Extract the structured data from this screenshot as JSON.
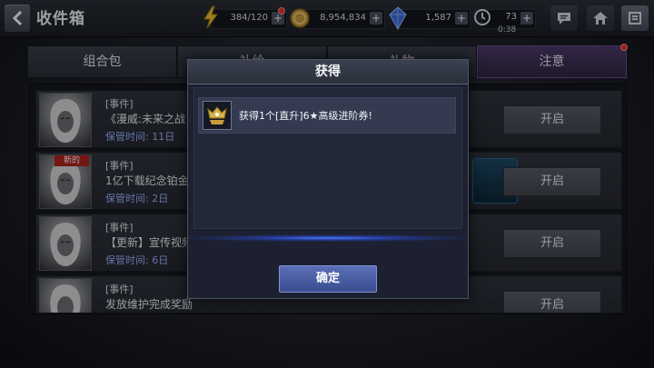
{
  "header": {
    "title": "收件箱",
    "back_icon": "chevron-left-icon",
    "energy": {
      "value": "384/120",
      "icon": "lightning-icon",
      "plus": "+"
    },
    "gold": {
      "value": "8,954,834",
      "icon": "coin-icon",
      "plus": "+"
    },
    "crystal": {
      "value": "1,587",
      "icon": "crystal-icon",
      "plus": "+"
    },
    "stamina": {
      "value": "73",
      "timer": "0:38",
      "icon": "timer-icon",
      "plus": "+"
    },
    "chat_icon": "chat-icon",
    "home_icon": "home-icon",
    "menu_icon": "menu-icon"
  },
  "tabs": [
    {
      "label": "组合包"
    },
    {
      "label": "补给"
    },
    {
      "label": "礼物"
    },
    {
      "label": "注意",
      "active": true
    }
  ],
  "mail_items": [
    {
      "category": "[事件]",
      "title": "《漫威:未来之战",
      "hold_time": "保管时间: 11日",
      "button": "开启"
    },
    {
      "category": "[事件]",
      "title": "1亿下载纪念铂金",
      "hold_time": "保管时间: 2日",
      "button": "开启",
      "badge": "新的"
    },
    {
      "category": "[事件]",
      "title": "【更新】宣传视频",
      "hold_time": "保管时间: 6日",
      "button": "开启"
    },
    {
      "category": "[事件]",
      "title": "发放维护完成奖励",
      "hold_time": "",
      "button": "开启"
    }
  ],
  "modal": {
    "title": "获得",
    "reward_text": "获得1个[直升]6★高级进阶券!",
    "reward_icon": "rank-badge-icon",
    "confirm": "确定"
  },
  "colors": {
    "accent_blue": "#4a78ff",
    "active_tab": "#4e3a6e",
    "badge_red": "#b3231d",
    "hold_text": "#9fb4ff"
  }
}
